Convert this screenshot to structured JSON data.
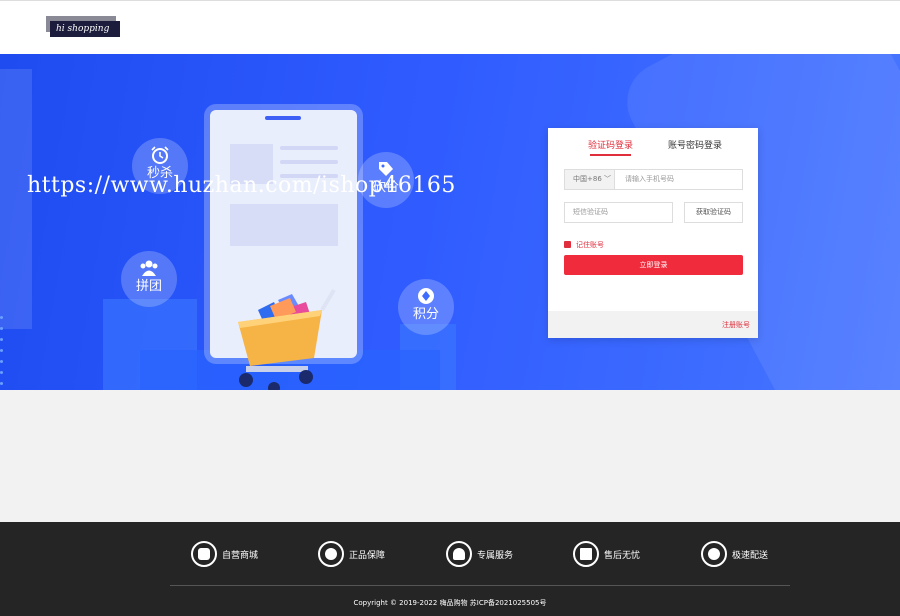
{
  "header": {
    "logo_text": "hi shopping"
  },
  "banner": {
    "watermark": "https://www.huzhan.com/ishop46165",
    "bubbles": [
      {
        "label": "秒杀",
        "icon": "alarm-clock-icon"
      },
      {
        "label": "砍价",
        "icon": "price-tag-icon"
      },
      {
        "label": "拼团",
        "icon": "group-users-icon"
      },
      {
        "label": "积分",
        "icon": "diamond-icon"
      }
    ]
  },
  "login": {
    "tabs": [
      {
        "label": "验证码登录",
        "active": true
      },
      {
        "label": "账号密码登录",
        "active": false
      }
    ],
    "phone_prefix": "中国+86",
    "phone_placeholder": "请输入手机号码",
    "code_placeholder": "短信验证码",
    "code_button": "获取验证码",
    "remember": "记住账号",
    "submit": "立即登录",
    "register": "注册账号",
    "accent_color": "#f02b3c"
  },
  "footer": {
    "features": [
      {
        "label": "自营商城",
        "icon": "store-icon"
      },
      {
        "label": "正品保障",
        "icon": "award-badge-icon"
      },
      {
        "label": "专属服务",
        "icon": "service-agent-icon"
      },
      {
        "label": "售后无忧",
        "icon": "delivery-truck-icon"
      },
      {
        "label": "极速配送",
        "icon": "yen-coin-icon"
      }
    ],
    "copyright": "Copyright © 2019-2022 嗨品购物 苏ICP备2021025505号"
  }
}
